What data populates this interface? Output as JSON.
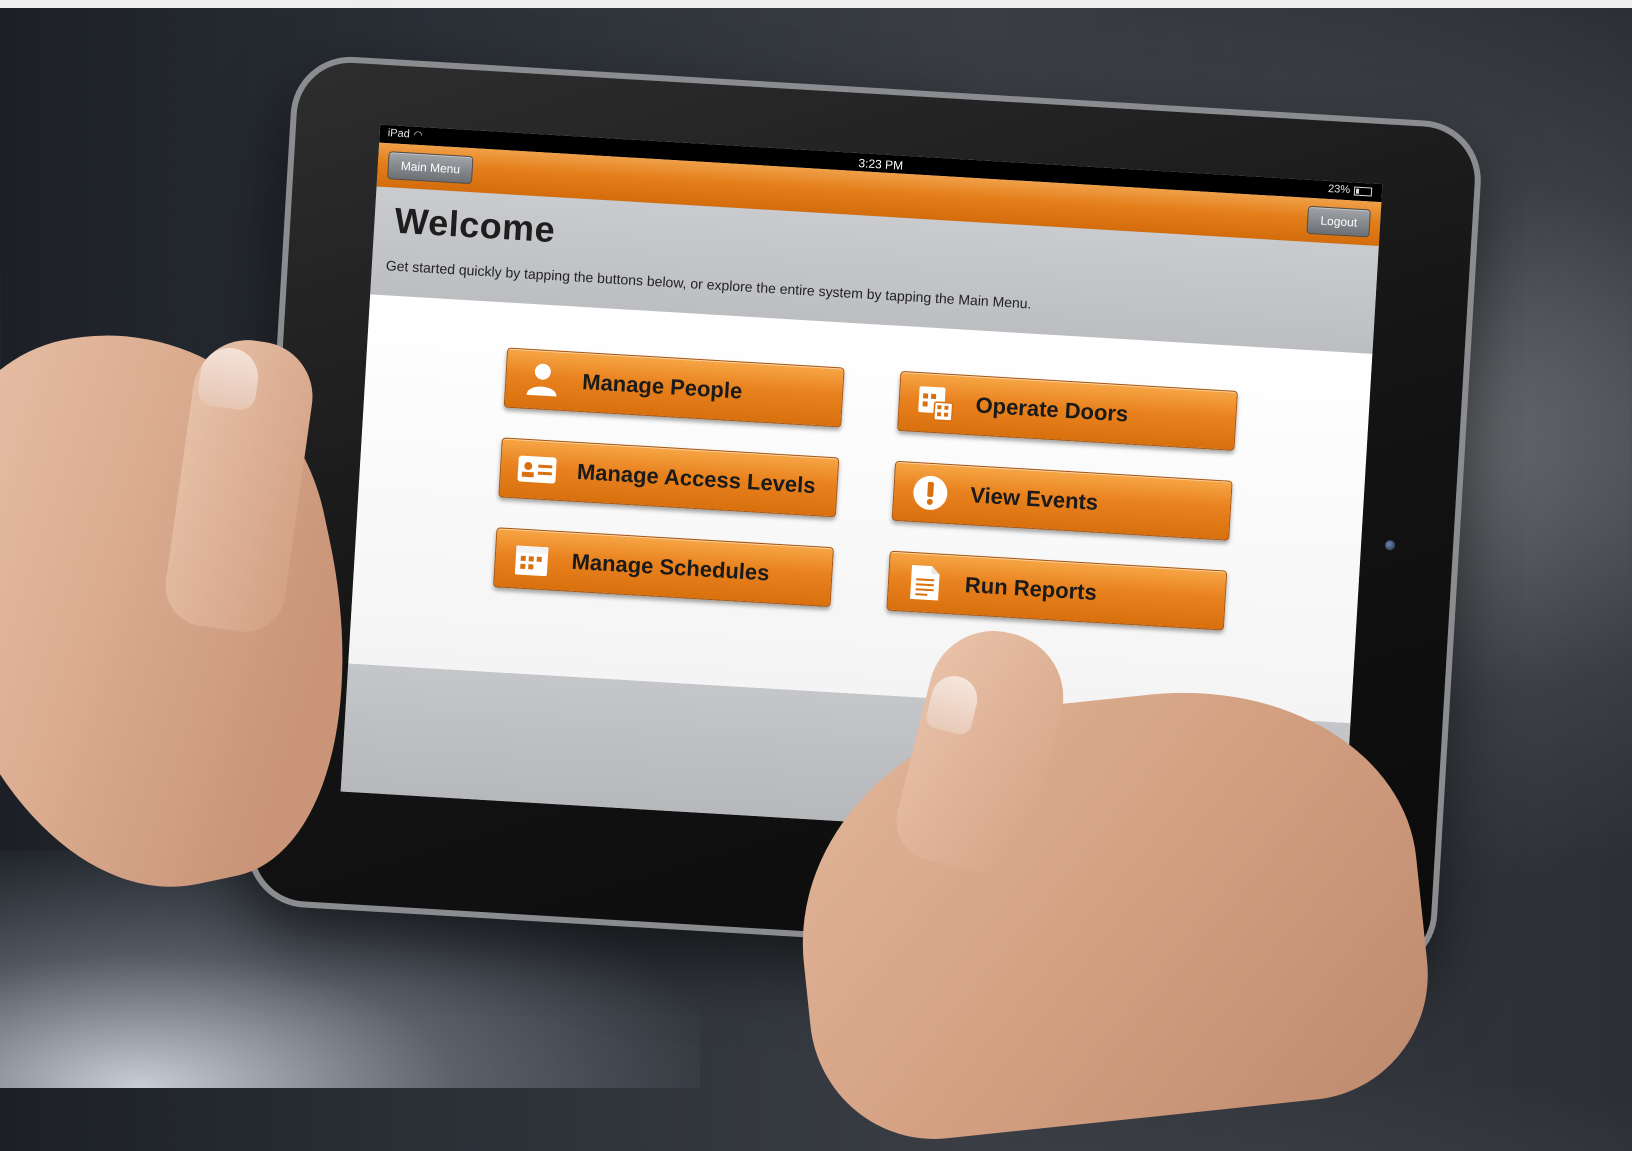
{
  "status_bar": {
    "device": "iPad",
    "battery": "23%"
  },
  "nav": {
    "main_menu_label": "Main Menu",
    "time": "3:23 PM",
    "logout_label": "Logout"
  },
  "header": {
    "title": "Welcome",
    "subtitle": "Get started quickly by tapping the buttons below, or explore the entire system by tapping the Main Menu."
  },
  "buttons": [
    {
      "label": "Manage People",
      "icon": "person-icon"
    },
    {
      "label": "Manage Access Levels",
      "icon": "id-card-icon"
    },
    {
      "label": "Manage Schedules",
      "icon": "calendar-icon"
    },
    {
      "label": "Operate Doors",
      "icon": "door-calendar-icon"
    },
    {
      "label": "View Events",
      "icon": "alert-icon"
    },
    {
      "label": "Run Reports",
      "icon": "document-icon"
    }
  ],
  "colors": {
    "accent": "#e8821e",
    "nav_bar": "#e47e1a",
    "screen_gray": "#bcbec1"
  }
}
